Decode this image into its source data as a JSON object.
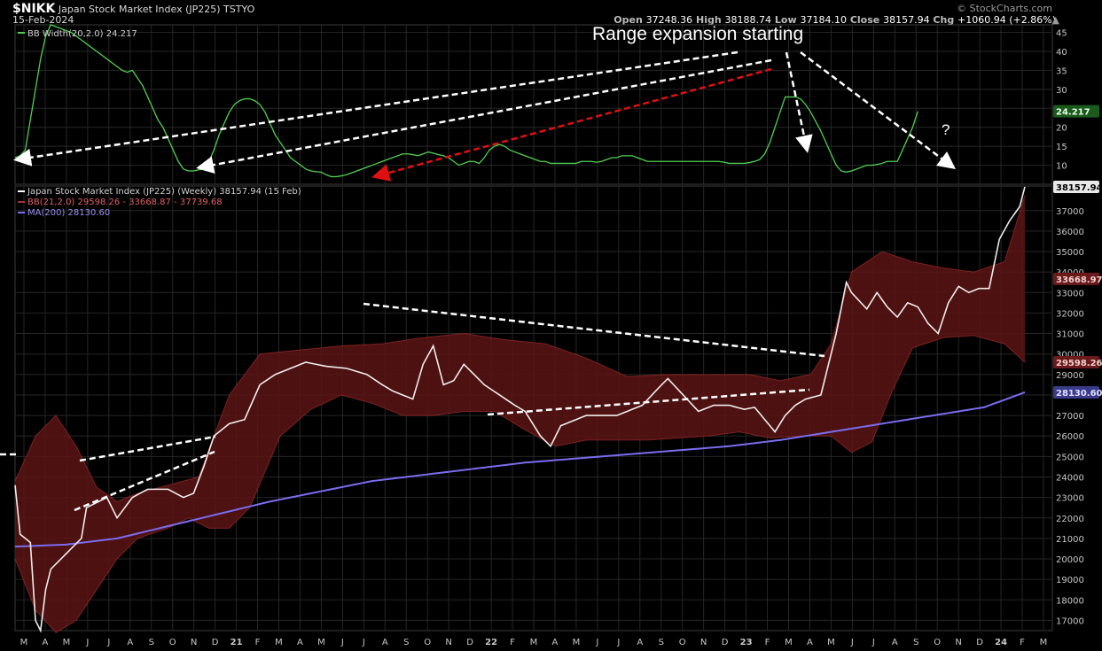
{
  "header": {
    "symbol": "$NIKK",
    "name": "Japan Stock Market Index (JP225)",
    "exchange": "TSTYO",
    "date": "15-Feb-2024",
    "source": "© StockCharts.com",
    "open_label": "Open",
    "open": "37248.36",
    "high_label": "High",
    "high": "38188.74",
    "low_label": "Low",
    "low": "37184.10",
    "close_label": "Close",
    "close": "38157.94",
    "chg_label": "Chg",
    "chg": "+1060.94 (+2.86%)"
  },
  "colors": {
    "background": "#000000",
    "price": "#ffffff",
    "bands_fill": "#5a1414",
    "bands_edge": "#b03030",
    "ma200": "#7b6cf0",
    "bbwidth": "#4fcf4f",
    "annotation": "#ffffff",
    "annotation_red": "#e01010",
    "grid": "#262626"
  },
  "chart_data": [
    {
      "type": "line",
      "panel": "upper",
      "legend": [
        "BB Width(20,2.0) 24.217"
      ],
      "annotation_text": "Range expansion starting",
      "question_mark": "?",
      "ylim": [
        5,
        47
      ],
      "y_ticks": [
        10,
        15,
        20,
        25,
        30,
        35,
        40,
        45
      ],
      "last_value_label": "24.217",
      "series": [
        {
          "name": "BB Width(20,2.0)",
          "values": [
            12,
            12.5,
            14,
            22,
            30,
            38,
            44,
            47,
            46.5,
            46,
            45.5,
            45,
            44,
            43,
            42,
            41,
            40,
            39,
            38,
            37,
            36,
            35,
            34.5,
            35,
            33,
            31,
            28,
            25,
            22,
            20,
            17,
            14,
            11,
            9,
            8.5,
            8.5,
            8.8,
            9,
            11,
            14,
            18,
            21,
            24,
            26,
            27,
            27.5,
            27.5,
            27,
            26,
            24,
            21,
            18,
            16,
            14,
            12,
            11,
            10,
            9,
            8.5,
            8.3,
            8.2,
            7.5,
            7,
            7,
            7.2,
            7.5,
            8,
            8.5,
            9,
            9.5,
            10,
            10.5,
            11,
            11.5,
            12,
            12.5,
            13,
            13,
            12.8,
            12.5,
            13,
            13.5,
            13.2,
            12.8,
            12.5,
            12,
            11,
            10,
            10.5,
            11,
            11,
            10.5,
            12,
            14,
            15,
            15.5,
            15,
            14,
            13.5,
            13,
            12.5,
            12,
            11.5,
            11,
            11,
            10.5,
            10.5,
            10.5,
            10.5,
            10.5,
            10.5,
            11,
            11,
            11,
            10.8,
            11,
            11.5,
            12,
            12,
            12.5,
            12.5,
            12.5,
            12,
            11.5,
            11,
            11,
            11,
            11,
            11,
            11,
            11,
            11,
            11,
            11,
            11,
            11,
            11,
            11,
            11,
            10.8,
            10.5,
            10.5,
            10.5,
            10.5,
            10.7,
            11,
            11.5,
            13,
            16,
            20,
            24,
            28,
            28,
            28,
            27.5,
            26,
            24,
            21.5,
            19,
            16,
            13,
            10,
            8.5,
            8.2,
            8.5,
            9,
            9.5,
            10,
            10,
            10.2,
            10.5,
            11,
            11,
            11,
            14,
            17,
            20,
            24.2
          ]
        }
      ]
    },
    {
      "type": "line",
      "panel": "lower",
      "legend": [
        "Japan Stock Market Index (JP225) (Weekly) 38157.94 (15 Feb)",
        "BB(21,2.0) 29598.26 - 33668.87 - 37739.68",
        "MA(200) 28130.60"
      ],
      "ylim": [
        16500,
        38200
      ],
      "y_ticks": [
        17000,
        18000,
        19000,
        20000,
        21000,
        22000,
        23000,
        24000,
        25000,
        26000,
        27000,
        28000,
        29000,
        30000,
        31000,
        32000,
        33000,
        34000,
        35000,
        36000,
        37000
      ],
      "price_labels": [
        "38157.94",
        "33668.97",
        "29598.26",
        "28130.60"
      ],
      "x_labels": [
        "M",
        "A",
        "M",
        "J",
        "J",
        "A",
        "S",
        "O",
        "N",
        "D",
        "21",
        "F",
        "M",
        "A",
        "M",
        "J",
        "J",
        "A",
        "S",
        "O",
        "N",
        "D",
        "22",
        "F",
        "M",
        "A",
        "M",
        "J",
        "J",
        "A",
        "S",
        "O",
        "N",
        "D",
        "23",
        "F",
        "M",
        "A",
        "M",
        "J",
        "J",
        "A",
        "S",
        "O",
        "N",
        "D",
        "24",
        "F",
        "M"
      ],
      "series": [
        {
          "name": "Japan Stock Market Index (JP225) (Weekly)",
          "knots": [
            [
              0,
              23600
            ],
            [
              1,
              21200
            ],
            [
              3,
              20800
            ],
            [
              4,
              17000
            ],
            [
              5,
              16500
            ],
            [
              6,
              18500
            ],
            [
              7,
              19500
            ],
            [
              9,
              20000
            ],
            [
              11,
              20500
            ],
            [
              13,
              21000
            ],
            [
              14,
              22500
            ],
            [
              18,
              23000
            ],
            [
              20,
              22000
            ],
            [
              23,
              23000
            ],
            [
              26,
              23400
            ],
            [
              30,
              23400
            ],
            [
              33,
              23000
            ],
            [
              35,
              23200
            ],
            [
              37,
              24500
            ],
            [
              39,
              26000
            ],
            [
              42,
              26600
            ],
            [
              45,
              26800
            ],
            [
              48,
              28500
            ],
            [
              51,
              29000
            ],
            [
              54,
              29300
            ],
            [
              57,
              29600
            ],
            [
              61,
              29400
            ],
            [
              65,
              29300
            ],
            [
              69,
              29000
            ],
            [
              72,
              28500
            ],
            [
              74,
              28200
            ],
            [
              76,
              28000
            ],
            [
              78,
              27800
            ],
            [
              80,
              29500
            ],
            [
              82,
              30400
            ],
            [
              84,
              28500
            ],
            [
              86,
              28700
            ],
            [
              88,
              29500
            ],
            [
              92,
              28500
            ],
            [
              95,
              28000
            ],
            [
              98,
              27500
            ],
            [
              100,
              27200
            ],
            [
              103,
              26000
            ],
            [
              105,
              25500
            ],
            [
              107,
              26500
            ],
            [
              109,
              26700
            ],
            [
              112,
              27000
            ],
            [
              115,
              27000
            ],
            [
              118,
              27000
            ],
            [
              120,
              27200
            ],
            [
              123,
              27500
            ],
            [
              126,
              28300
            ],
            [
              128,
              28800
            ],
            [
              131,
              28000
            ],
            [
              134,
              27200
            ],
            [
              137,
              27500
            ],
            [
              140,
              27500
            ],
            [
              143,
              27300
            ],
            [
              145,
              27400
            ],
            [
              147,
              26800
            ],
            [
              149,
              26200
            ],
            [
              151,
              27000
            ],
            [
              153,
              27500
            ],
            [
              155,
              27800
            ],
            [
              158,
              28000
            ],
            [
              159,
              29000
            ],
            [
              161,
              31000
            ],
            [
              163,
              33500
            ],
            [
              164,
              33000
            ],
            [
              167,
              32200
            ],
            [
              169,
              33000
            ],
            [
              171,
              32300
            ],
            [
              173,
              31800
            ],
            [
              175,
              32500
            ],
            [
              177,
              32300
            ],
            [
              179,
              31500
            ],
            [
              181,
              31000
            ],
            [
              183,
              32500
            ],
            [
              185,
              33300
            ],
            [
              187,
              33000
            ],
            [
              189,
              33200
            ],
            [
              191,
              33200
            ],
            [
              193,
              35600
            ],
            [
              195,
              36500
            ],
            [
              197,
              37200
            ],
            [
              198,
              38158
            ]
          ]
        },
        {
          "name": "MA(200)",
          "knots": [
            [
              0,
              20600
            ],
            [
              10,
              20700
            ],
            [
              20,
              21000
            ],
            [
              30,
              21600
            ],
            [
              40,
              22200
            ],
            [
              50,
              22800
            ],
            [
              60,
              23300
            ],
            [
              70,
              23800
            ],
            [
              80,
              24100
            ],
            [
              90,
              24400
            ],
            [
              100,
              24700
            ],
            [
              110,
              24900
            ],
            [
              120,
              25100
            ],
            [
              130,
              25300
            ],
            [
              140,
              25500
            ],
            [
              150,
              25800
            ],
            [
              160,
              26200
            ],
            [
              170,
              26600
            ],
            [
              180,
              27000
            ],
            [
              190,
              27400
            ],
            [
              198,
              28130
            ]
          ]
        },
        {
          "name": "BB(21,2.0) upper",
          "knots": [
            [
              0,
              23800
            ],
            [
              4,
              26000
            ],
            [
              8,
              27000
            ],
            [
              12,
              25500
            ],
            [
              16,
              23500
            ],
            [
              20,
              22800
            ],
            [
              24,
              23200
            ],
            [
              30,
              23600
            ],
            [
              36,
              24000
            ],
            [
              42,
              28000
            ],
            [
              48,
              30000
            ],
            [
              56,
              30200
            ],
            [
              64,
              30400
            ],
            [
              72,
              30500
            ],
            [
              80,
              30800
            ],
            [
              88,
              31000
            ],
            [
              96,
              30700
            ],
            [
              104,
              30500
            ],
            [
              112,
              29800
            ],
            [
              120,
              28900
            ],
            [
              128,
              29000
            ],
            [
              136,
              29000
            ],
            [
              144,
              29000
            ],
            [
              150,
              28700
            ],
            [
              156,
              29000
            ],
            [
              160,
              30500
            ],
            [
              164,
              34000
            ],
            [
              170,
              35000
            ],
            [
              176,
              34500
            ],
            [
              182,
              34200
            ],
            [
              188,
              34000
            ],
            [
              194,
              34500
            ],
            [
              198,
              37740
            ]
          ]
        },
        {
          "name": "BB(21,2.0) lower",
          "knots": [
            [
              0,
              20000
            ],
            [
              4,
              17500
            ],
            [
              8,
              16400
            ],
            [
              12,
              17000
            ],
            [
              16,
              18500
            ],
            [
              20,
              20000
            ],
            [
              24,
              21000
            ],
            [
              30,
              21500
            ],
            [
              34,
              22000
            ],
            [
              38,
              21500
            ],
            [
              42,
              21500
            ],
            [
              46,
              22500
            ],
            [
              52,
              26000
            ],
            [
              58,
              27300
            ],
            [
              64,
              28000
            ],
            [
              70,
              27600
            ],
            [
              76,
              27000
            ],
            [
              82,
              27000
            ],
            [
              88,
              27200
            ],
            [
              94,
              27200
            ],
            [
              100,
              26300
            ],
            [
              106,
              25500
            ],
            [
              112,
              25800
            ],
            [
              118,
              25800
            ],
            [
              124,
              25800
            ],
            [
              130,
              25900
            ],
            [
              136,
              26000
            ],
            [
              142,
              26200
            ],
            [
              148,
              25900
            ],
            [
              154,
              26000
            ],
            [
              160,
              26000
            ],
            [
              164,
              25200
            ],
            [
              168,
              25700
            ],
            [
              172,
              28200
            ],
            [
              176,
              30300
            ],
            [
              182,
              30800
            ],
            [
              188,
              30900
            ],
            [
              194,
              30500
            ],
            [
              198,
              29600
            ]
          ]
        }
      ]
    }
  ]
}
